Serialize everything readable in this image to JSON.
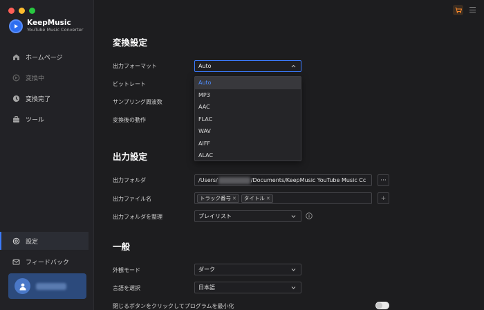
{
  "app": {
    "name": "KeepMusic",
    "subtitle": "YouTube Music Converter"
  },
  "colors": {
    "accent": "#3b7bff",
    "traffic_red": "#ff5f57",
    "traffic_yellow": "#febc2e",
    "traffic_green": "#28c840"
  },
  "sidebar": {
    "items": [
      {
        "label": "ホームページ",
        "icon": "home-icon"
      },
      {
        "label": "変換中",
        "icon": "converting-icon"
      },
      {
        "label": "変換完了",
        "icon": "clock-icon"
      },
      {
        "label": "ツール",
        "icon": "toolbox-icon"
      }
    ],
    "settings": {
      "label": "設定",
      "icon": "gear-icon"
    },
    "feedback": {
      "label": "フィードバック",
      "icon": "mail-icon"
    }
  },
  "conversion": {
    "title": "変換設定",
    "format_label": "出力フォーマット",
    "format_value": "Auto",
    "bitrate_label": "ビットレート",
    "samplerate_label": "サンプリング周波数",
    "after_label": "変換後の動作",
    "format_options": [
      "Auto",
      "MP3",
      "AAC",
      "FLAC",
      "WAV",
      "AIFF",
      "ALAC"
    ]
  },
  "output": {
    "title": "出力設定",
    "folder_label": "出力フォルダ",
    "folder_prefix": "/Users/",
    "folder_suffix": "/Documents/KeepMusic YouTube Music Cc",
    "browse_label": "···",
    "filename_label": "出力ファイル名",
    "filename_tags": [
      "トラック番号",
      "タイトル"
    ],
    "add_label": "+",
    "organize_label": "出力フォルダを整理",
    "organize_value": "プレイリスト"
  },
  "general": {
    "title": "一般",
    "appearance_label": "外観モード",
    "appearance_value": "ダーク",
    "language_label": "言語を選択",
    "language_value": "日本語",
    "minimize_label": "閉じるボタンをクリックしてプログラムを最小化"
  }
}
